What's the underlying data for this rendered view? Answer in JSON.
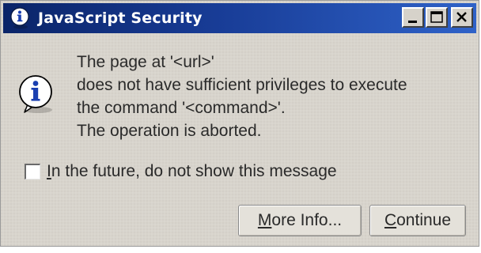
{
  "window": {
    "title": "JavaScript Security",
    "controls": {
      "minimize_icon": "minimize-icon",
      "maximize_icon": "maximize-icon",
      "close_icon": "close-icon"
    },
    "title_icon": "info-icon"
  },
  "message": {
    "icon": "info-icon",
    "lines": [
      "The page at '<url>'",
      "does not have sufficient privileges to execute",
      "the command '<command>'.",
      "The operation is aborted."
    ]
  },
  "checkbox": {
    "mnemonic": "I",
    "label_rest": "n the future, do not show this message",
    "checked": false
  },
  "buttons": {
    "more_info": {
      "mnemonic": "M",
      "rest": "ore Info..."
    },
    "continue": {
      "mnemonic": "C",
      "rest": "ontinue"
    }
  },
  "colors": {
    "titlebar_start": "#0a2468",
    "titlebar_end": "#2f62c8",
    "dialog_bg": "#d8d4cc",
    "info_icon_blue": "#1a3fb0"
  }
}
